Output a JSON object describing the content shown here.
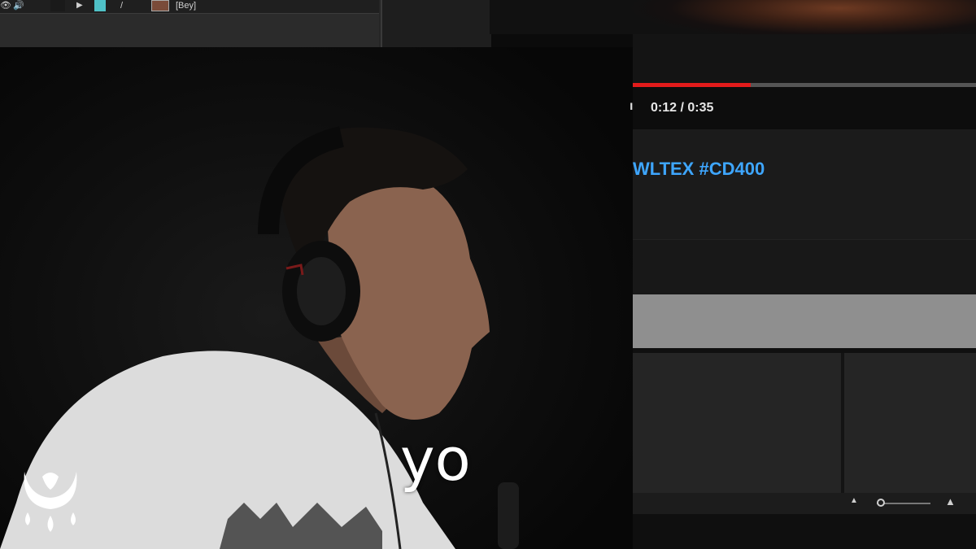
{
  "editor": {
    "toolbar": {
      "eye_icon": "eye-icon",
      "speaker_icon": "speaker-icon",
      "play_icon": "play-icon",
      "pen_icon": "pen-icon",
      "layer_label": "[Bey]",
      "eye_glyph": "👁",
      "speaker_glyph": "🔊",
      "play_glyph": "▶",
      "pen_glyph": "/",
      "label_color": "#4fc1c7"
    }
  },
  "video_player": {
    "progress": 0.343,
    "time_display": "0:12 / 0:35",
    "title_hashtags": "WLTEX #CD400",
    "progress_color": "#e31b1b",
    "hashtag_color": "#3ea6ff"
  },
  "zoom_controls": {
    "zoom_out_glyph": "▲",
    "zoom_in_glyph": "▲",
    "level": 0.05
  },
  "caption": {
    "text": "yo"
  },
  "logo": {
    "name": "crescent-drops-logo"
  }
}
